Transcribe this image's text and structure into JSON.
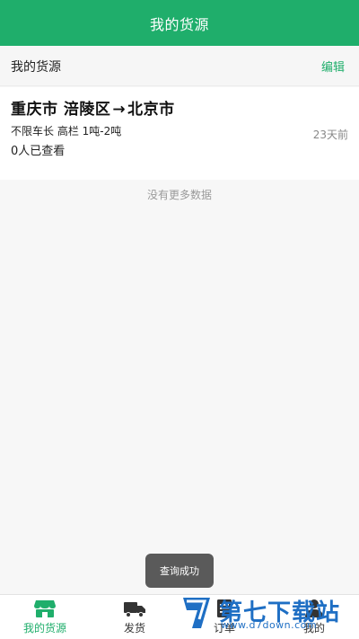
{
  "header": {
    "title": "我的货源"
  },
  "section": {
    "label": "我的货源",
    "edit_label": "编辑"
  },
  "cargo": {
    "origin": "重庆市 涪陵区",
    "arrow": "→",
    "destination": "北京市",
    "spec": "不限车长 高栏 1吨-2吨",
    "viewed": "0人已查看",
    "time": "23天前"
  },
  "list_end": "没有更多数据",
  "toast": "查询成功",
  "tabs": [
    {
      "label": "我的货源",
      "icon": "store-icon",
      "active": true
    },
    {
      "label": "发货",
      "icon": "truck-icon",
      "active": false
    },
    {
      "label": "订单",
      "icon": "order-icon",
      "active": false
    },
    {
      "label": "我的",
      "icon": "person-icon",
      "active": false
    }
  ],
  "watermark": {
    "name": "第七下载站",
    "url": "www.d7down.com"
  },
  "colors": {
    "brand": "#1fae6b",
    "watermark": "#1f6fc4"
  }
}
